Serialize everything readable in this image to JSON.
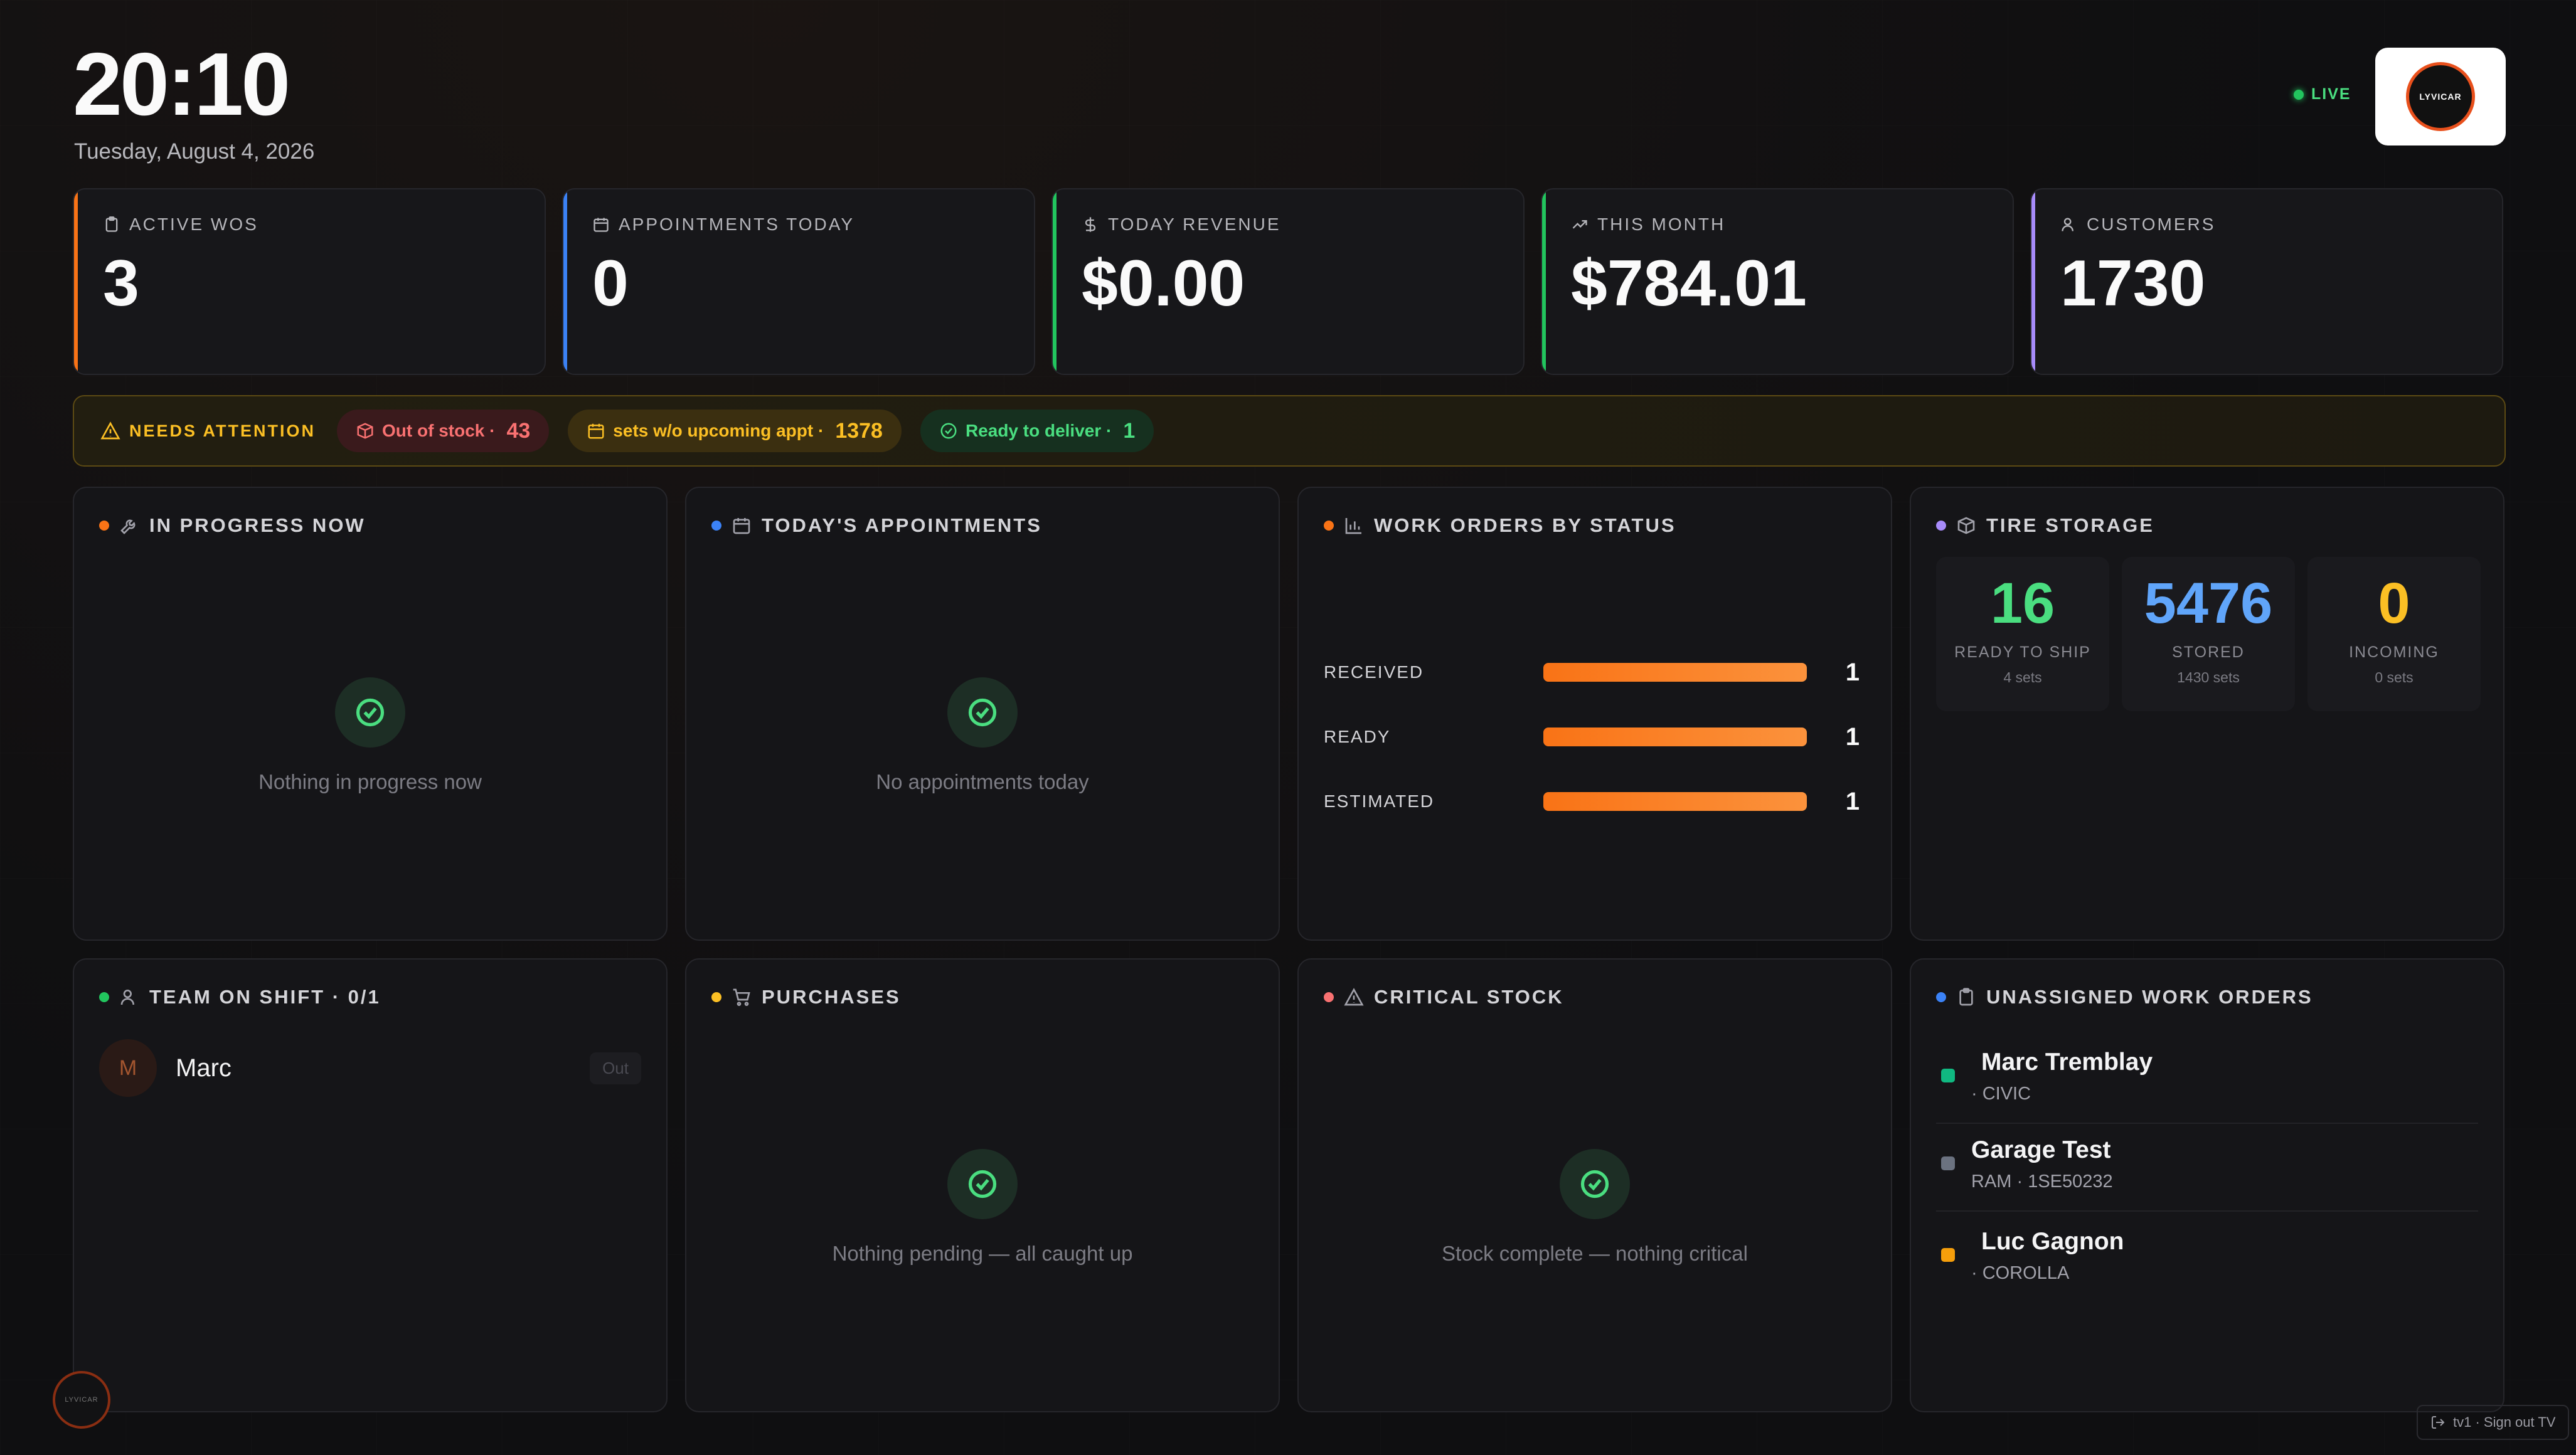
{
  "header": {
    "time": "20:10",
    "date": "Tuesday, August 4, 2026",
    "live_label": "LIVE",
    "logo_text": "LYVICAR"
  },
  "kpis": [
    {
      "label": "ACTIVE WOS",
      "value": "3",
      "accent": "#f97316",
      "icon": "clipboard-icon"
    },
    {
      "label": "APPOINTMENTS TODAY",
      "value": "0",
      "accent": "#3b82f6",
      "icon": "calendar-icon"
    },
    {
      "label": "TODAY REVENUE",
      "value": "$0.00",
      "accent": "#22c55e",
      "icon": "dollar-icon"
    },
    {
      "label": "THIS MONTH",
      "value": "$784.01",
      "accent": "#22c55e",
      "icon": "trending-up-icon"
    },
    {
      "label": "CUSTOMERS",
      "value": "1730",
      "accent": "#a78bfa",
      "icon": "user-icon"
    }
  ],
  "attention": {
    "title": "NEEDS ATTENTION",
    "chips": [
      {
        "label": "Out of stock ·",
        "count": "43",
        "tone": "red",
        "icon": "box-icon"
      },
      {
        "label": "sets w/o upcoming appt ·",
        "count": "1378",
        "tone": "amber",
        "icon": "calendar-icon"
      },
      {
        "label": "Ready to deliver ·",
        "count": "1",
        "tone": "green",
        "icon": "check-circle-icon"
      }
    ]
  },
  "panels": {
    "in_progress": {
      "title": "IN PROGRESS NOW",
      "empty": "Nothing in progress now",
      "dot": "#f97316"
    },
    "appointments": {
      "title": "TODAY'S APPOINTMENTS",
      "empty": "No appointments today",
      "dot": "#3b82f6"
    },
    "work_orders": {
      "title": "WORK ORDERS BY STATUS",
      "dot": "#f97316",
      "rows": [
        {
          "label": "RECEIVED",
          "value": "1"
        },
        {
          "label": "READY",
          "value": "1"
        },
        {
          "label": "ESTIMATED",
          "value": "1"
        }
      ]
    },
    "tire_storage": {
      "title": "TIRE STORAGE",
      "dot": "#a78bfa",
      "boxes": [
        {
          "value": "16",
          "label": "READY TO SHIP",
          "sub": "4 sets",
          "color": "#4ade80"
        },
        {
          "value": "5476",
          "label": "STORED",
          "sub": "1430 sets",
          "color": "#60a5fa"
        },
        {
          "value": "0",
          "label": "INCOMING",
          "sub": "0 sets",
          "color": "#fbbf24"
        }
      ]
    },
    "team": {
      "title": "TEAM ON SHIFT · 0/1",
      "dot": "#22c55e",
      "members": [
        {
          "initial": "M",
          "name": "Marc",
          "status": "Out"
        }
      ]
    },
    "purchases": {
      "title": "PURCHASES",
      "empty": "Nothing pending — all caught up",
      "dot": "#fbbf24"
    },
    "critical_stock": {
      "title": "CRITICAL STOCK",
      "empty": "Stock complete — nothing critical",
      "dot": "#f87171"
    },
    "unassigned": {
      "title": "UNASSIGNED WORK ORDERS",
      "dot": "#3b82f6",
      "items": [
        {
          "name": "Marc Tremblay",
          "sub": "· CIVIC",
          "color": "#10b981"
        },
        {
          "name": "Garage Test",
          "sub": "RAM · 1SE50232",
          "color": "#6b7280"
        },
        {
          "name": "Luc Gagnon",
          "sub": "· COROLLA",
          "color": "#f59e0b"
        }
      ]
    }
  },
  "chart_data": {
    "type": "bar",
    "title": "WORK ORDERS BY STATUS",
    "categories": [
      "RECEIVED",
      "READY",
      "ESTIMATED"
    ],
    "values": [
      1,
      1,
      1
    ]
  },
  "footer": {
    "logo_text": "LYVICAR",
    "signout_label": "tv1 · Sign out TV"
  }
}
